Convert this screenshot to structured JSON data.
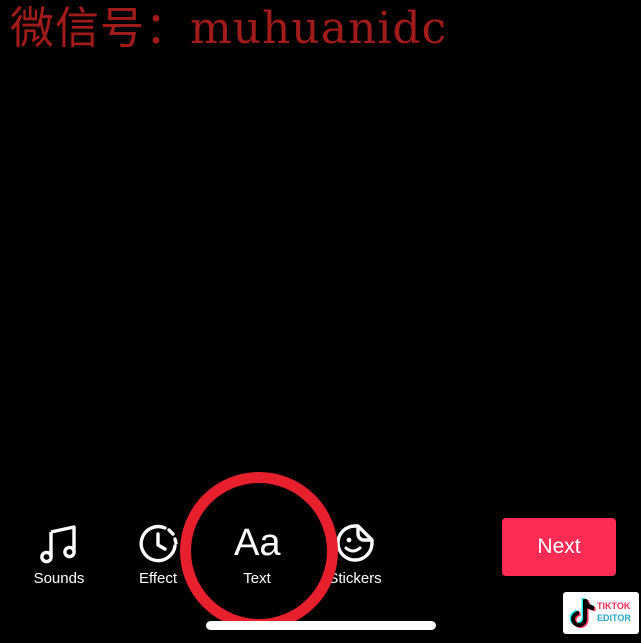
{
  "colors": {
    "background": "#000000",
    "accent": "#fe2c55",
    "highlight_ring": "#e8202d",
    "watermark": "#a11b1b",
    "text": "#ffffff"
  },
  "watermark": {
    "text": "微信号：muhuanidc"
  },
  "toolbar": {
    "items": [
      {
        "id": "sounds",
        "icon": "music-note-icon",
        "label": "Sounds"
      },
      {
        "id": "effects",
        "icon": "effects-timer-icon",
        "label": "Effect"
      },
      {
        "id": "text",
        "icon": "text-aa-icon",
        "glyph": "Aa",
        "label": "Text"
      },
      {
        "id": "stickers",
        "icon": "sticker-icon",
        "label": "Stickers"
      }
    ]
  },
  "next_button": {
    "label": "Next"
  },
  "corner_logo": {
    "icon": "tiktok-logo-icon",
    "line1": "TIKTOK",
    "line2": "EDITOR"
  }
}
